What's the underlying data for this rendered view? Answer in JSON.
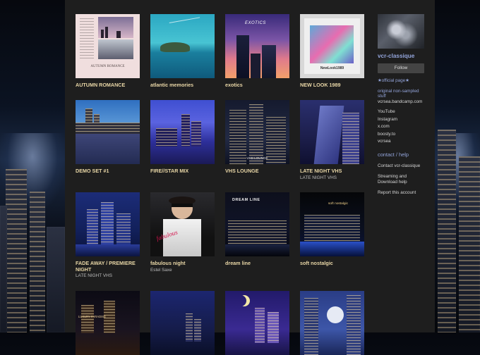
{
  "colors": {
    "panel": "#1e1e1e",
    "album_title": "#e8d6a6",
    "link": "#93a4da"
  },
  "albums": [
    {
      "title": "AUTUMN ROMANCE",
      "artist": "",
      "cover_text": "AUTUMN ROMANCE"
    },
    {
      "title": "atlantic memories",
      "artist": "",
      "cover_text": ""
    },
    {
      "title": "exotics",
      "artist": "",
      "cover_text": "EXOTICS"
    },
    {
      "title": "NEW LOOK 1989",
      "artist": "",
      "cover_text": "NewLook1989"
    },
    {
      "title": "DEMO SET #1",
      "artist": "",
      "cover_text": ""
    },
    {
      "title": "FIRE//STAR MIX",
      "artist": "",
      "cover_text": ""
    },
    {
      "title": "VHS LOUNGE",
      "artist": "",
      "cover_text": "VHS LOUNGE"
    },
    {
      "title": "LATE NIGHT VHS",
      "artist": "LATE NIGHT VHS",
      "cover_text": ""
    },
    {
      "title": "FADE AWAY / PREMIERE NIGHT",
      "artist": "LATE NIGHT VHS",
      "cover_text": ""
    },
    {
      "title": "fabulous night",
      "artist": "Estel Saxe",
      "cover_text": "fabulous"
    },
    {
      "title": "dream line",
      "artist": "",
      "cover_text": "DREAM LINE"
    },
    {
      "title": "soft nostalgic",
      "artist": "",
      "cover_text": "soft nostalgic"
    },
    {
      "title": "",
      "artist": "",
      "cover_text": "LUXURY PARADISE"
    },
    {
      "title": "",
      "artist": "",
      "cover_text": ""
    },
    {
      "title": "",
      "artist": "",
      "cover_text": ""
    },
    {
      "title": "",
      "artist": "",
      "cover_text": ""
    }
  ],
  "sidebar": {
    "band_name": "vcr-classique",
    "follow_label": "Follow",
    "official_page": "★official page★",
    "original_label": "original non-sampled stuff",
    "original_site": "vcrsea.bandcamp.com",
    "links": [
      "YouTube",
      "Instagram",
      "x.com",
      "boosty.to",
      "vcrsea"
    ],
    "contact_heading": "contact / help",
    "contact_links": [
      "Contact vcr-classique",
      "Streaming and Download help",
      "Report this account"
    ]
  }
}
